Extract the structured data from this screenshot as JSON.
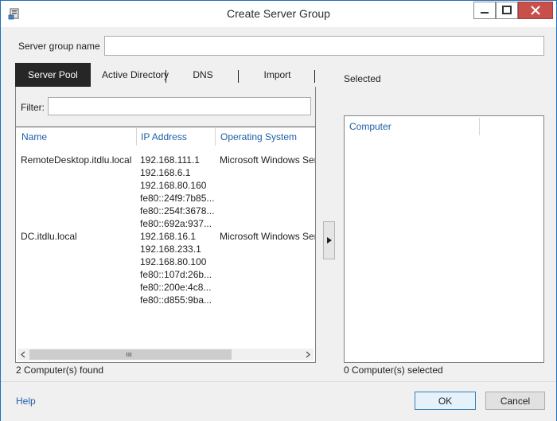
{
  "window": {
    "title": "Create Server Group"
  },
  "form": {
    "server_group_name_label": "Server group name",
    "server_group_name_value": ""
  },
  "tabs": [
    {
      "label": "Server Pool",
      "active": true
    },
    {
      "label": "Active Directory",
      "active": false
    },
    {
      "label": "DNS",
      "active": false
    },
    {
      "label": "Import",
      "active": false
    }
  ],
  "server_pool": {
    "filter_label": "Filter:",
    "filter_value": "",
    "columns": [
      "Name",
      "IP Address",
      "Operating System"
    ],
    "rows": [
      {
        "name": "RemoteDesktop.itdlu.local",
        "ips": [
          "192.168.111.1",
          "192.168.6.1",
          "192.168.80.160",
          "fe80::24f9:7b85...",
          "fe80::254f:3678...",
          "fe80::692a:937..."
        ],
        "os": "Microsoft Windows Server"
      },
      {
        "name": "DC.itdlu.local",
        "ips": [
          "192.168.16.1",
          "192.168.233.1",
          "192.168.80.100",
          "fe80::107d:26b...",
          "fe80::200e:4c8...",
          "fe80::d855:9ba..."
        ],
        "os": "Microsoft Windows Server"
      }
    ],
    "status": "2 Computer(s) found"
  },
  "selected": {
    "label": "Selected",
    "columns": [
      "Computer"
    ],
    "status": "0 Computer(s) selected"
  },
  "footer": {
    "help": "Help",
    "ok": "OK",
    "cancel": "Cancel"
  },
  "colors": {
    "accent": "#1e5fa8",
    "active_tab": "#262626",
    "close_button": "#c7504b",
    "border": "#1e6fb8"
  },
  "icons": {
    "app": "server-group-icon",
    "minimize": "minimize-icon",
    "maximize": "maximize-icon",
    "close": "close-icon",
    "move_right": "triangle-right-icon",
    "scroll_left": "chevron-left-icon",
    "scroll_right": "chevron-right-icon",
    "scroll_grip": "scroll-grip-icon"
  }
}
